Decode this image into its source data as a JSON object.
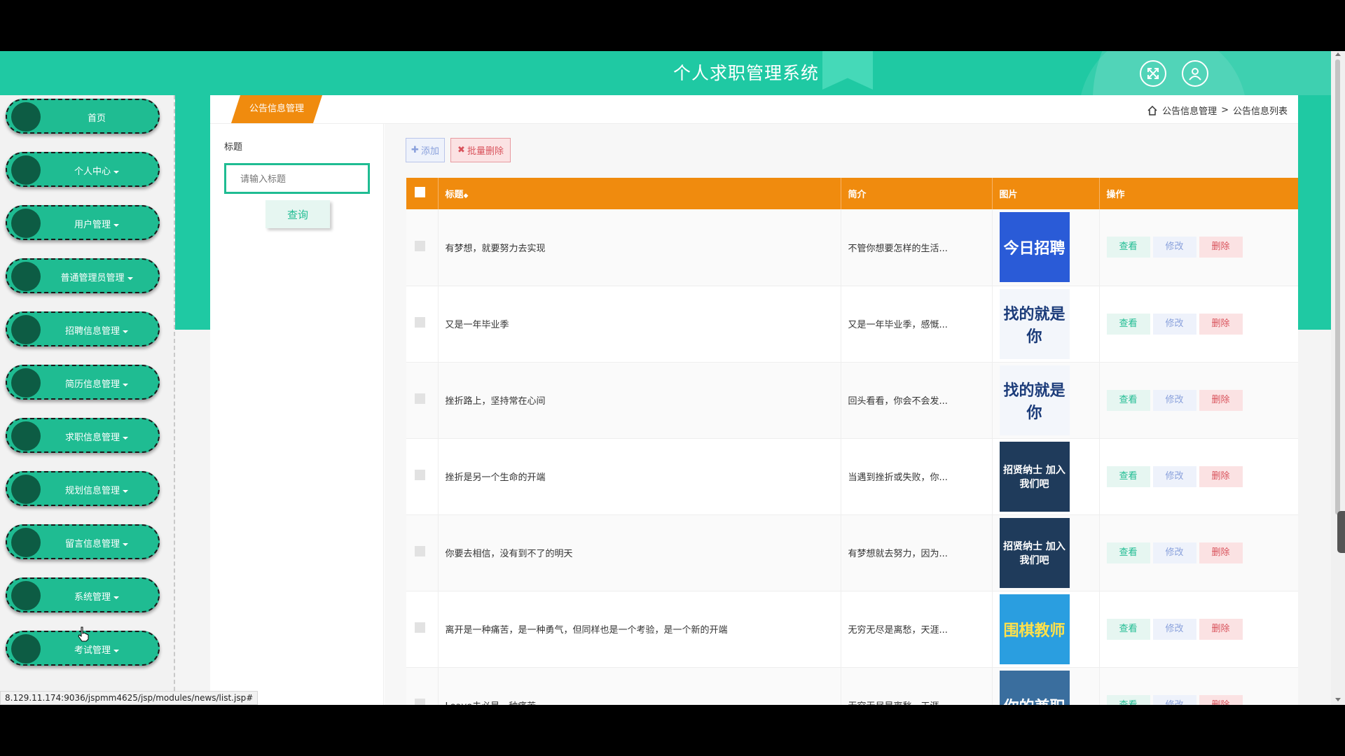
{
  "header": {
    "title": "个人求职管理系统",
    "expand_icon": "fullscreen-icon",
    "user_icon": "user-icon"
  },
  "sidebar": {
    "items": [
      {
        "label": "首页",
        "has_caret": false
      },
      {
        "label": "个人中心",
        "has_caret": true
      },
      {
        "label": "用户管理",
        "has_caret": true
      },
      {
        "label": "普通管理员管理",
        "has_caret": true
      },
      {
        "label": "招聘信息管理",
        "has_caret": true
      },
      {
        "label": "简历信息管理",
        "has_caret": true
      },
      {
        "label": "求职信息管理",
        "has_caret": true
      },
      {
        "label": "规划信息管理",
        "has_caret": true
      },
      {
        "label": "留言信息管理",
        "has_caret": true
      },
      {
        "label": "系统管理",
        "has_caret": true
      },
      {
        "label": "考试管理",
        "has_caret": true
      }
    ]
  },
  "tab": {
    "label": "公告信息管理"
  },
  "breadcrumb": {
    "home_icon": "home-icon",
    "first": "公告信息管理",
    "separator": ">",
    "current": "公告信息列表"
  },
  "search": {
    "field_label": "标题",
    "placeholder": "请输入标题",
    "button": "查询"
  },
  "toolbar": {
    "add": "添加",
    "batch_delete": "批量删除"
  },
  "table": {
    "columns": [
      "标题",
      "简介",
      "图片",
      "操作"
    ],
    "sort_indicator": "◆",
    "actions": {
      "view": "查看",
      "edit": "修改",
      "delete": "删除"
    },
    "rows": [
      {
        "title": "有梦想，就要努力去实现",
        "intro": "不管你想要怎样的生活...",
        "image": {
          "text": "今日招聘",
          "bg": "#2a5bd7",
          "fg": "#ffffff"
        }
      },
      {
        "title": "又是一年毕业季",
        "intro": "又是一年毕业季，感慨...",
        "image": {
          "text": "找的就是你",
          "bg": "#f3f6fb",
          "fg": "#1c3c7a"
        }
      },
      {
        "title": "挫折路上，坚持常在心间",
        "intro": "回头看看，你会不会发...",
        "image": {
          "text": "找的就是你",
          "bg": "#f3f6fb",
          "fg": "#1c3c7a"
        }
      },
      {
        "title": "挫折是另一个生命的开端",
        "intro": "当遇到挫折或失败，你...",
        "image": {
          "text": "招贤纳士 加入我们吧",
          "bg": "#1f3b5b",
          "fg": "#ffffff"
        }
      },
      {
        "title": "你要去相信，没有到不了的明天",
        "intro": "有梦想就去努力，因为...",
        "image": {
          "text": "招贤纳士 加入我们吧",
          "bg": "#1f3b5b",
          "fg": "#ffffff"
        }
      },
      {
        "title": "离开是一种痛苦，是一种勇气，但同样也是一个考验，是一个新的开端",
        "intro": "无穷无尽是离愁，天涯...",
        "image": {
          "text": "围棋教师",
          "bg": "#2a9ee0",
          "fg": "#ffe14a"
        }
      },
      {
        "title": "Leave未必是一种痛苦",
        "intro": "无穷无尽是离愁，天涯...",
        "image": {
          "text": "你的兼职",
          "bg": "#3a6e9e",
          "fg": "#ffffff"
        }
      }
    ]
  },
  "status_url": "8.129.11.174:9036/jspmm4625/jsp/modules/news/list.jsp#"
}
